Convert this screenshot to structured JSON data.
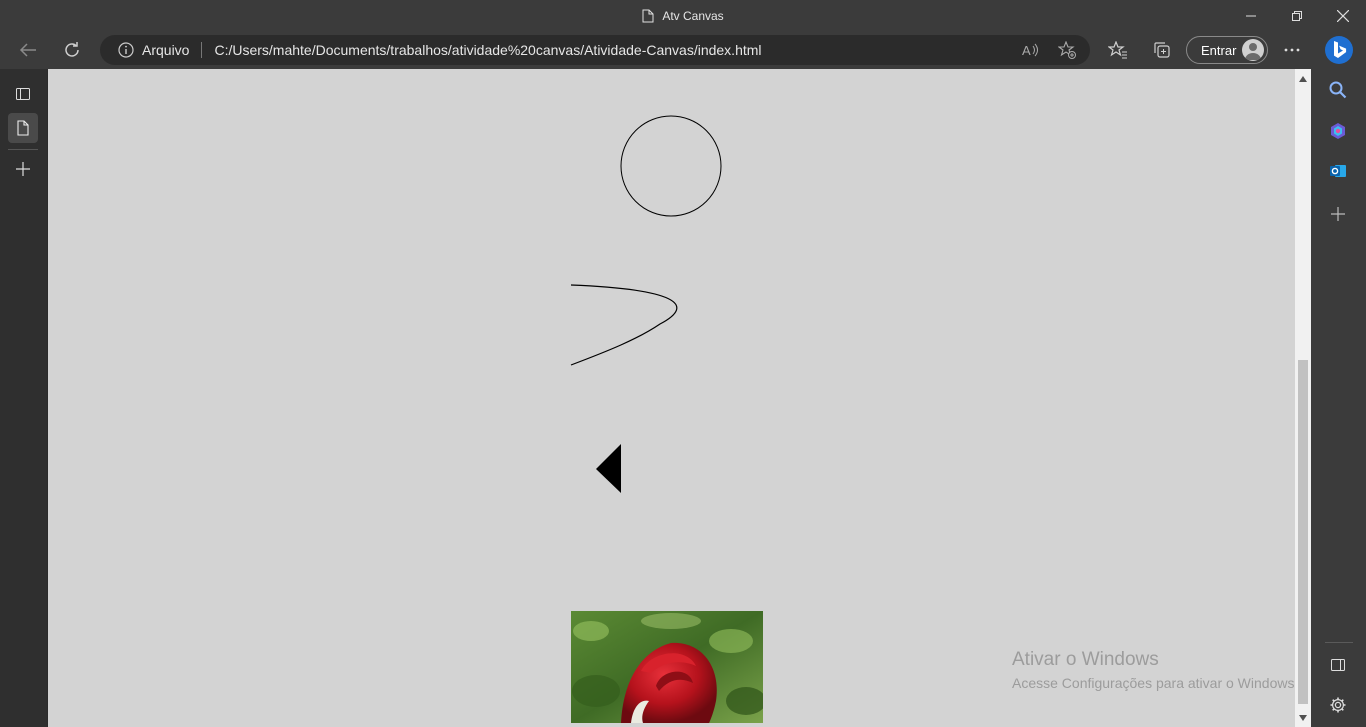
{
  "window": {
    "title": "Atv Canvas",
    "controls": {
      "minimize": "—",
      "restore": "❐",
      "close": "✕"
    }
  },
  "address_bar": {
    "info_label": "Arquivo",
    "url": "C:/Users/mahte/Documents/trabalhos/atividade%20canvas/Atividade-Canvas/index.html"
  },
  "profile": {
    "signin_label": "Entrar"
  },
  "page": {
    "background_color": "#d3d3d3",
    "watermark_title": "Ativar o Windows",
    "watermark_subtitle": "Acesse Configurações para ativar o Windows."
  },
  "icons": {
    "back": "back-arrow-icon",
    "refresh": "refresh-icon",
    "more": "ellipsis-icon"
  }
}
